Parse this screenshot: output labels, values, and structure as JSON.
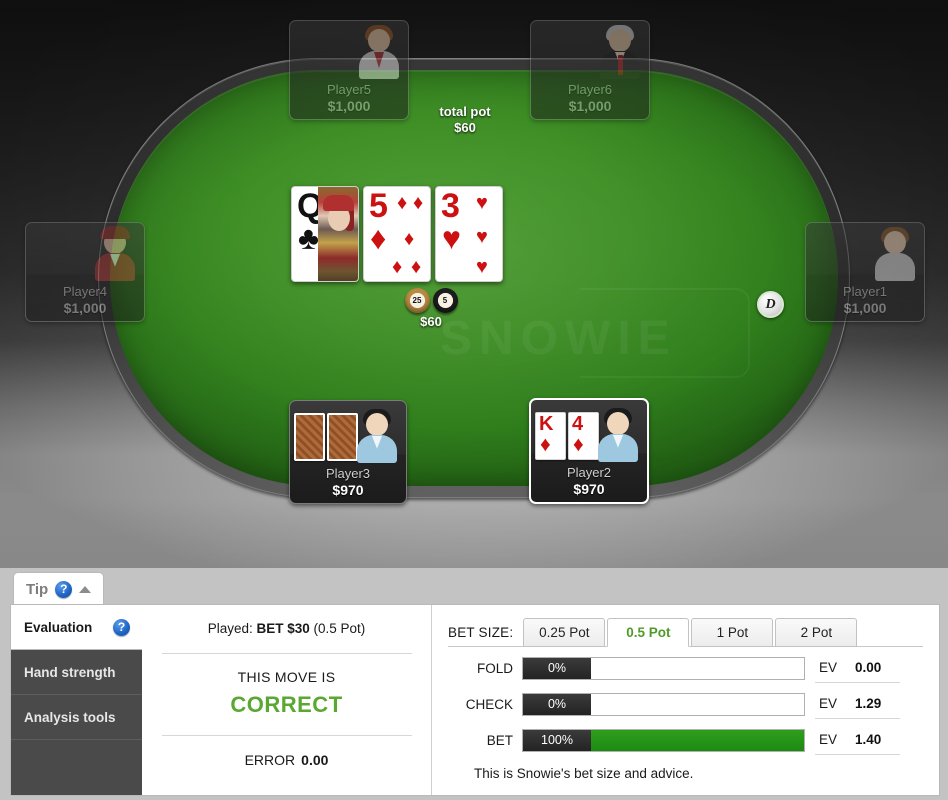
{
  "table": {
    "total_pot_label": "total pot",
    "total_pot_value": "$60",
    "pot_chips_amount": "$60",
    "chip_denominations": [
      "25",
      "5"
    ],
    "dealer_button_label": "D",
    "felt_watermark": "SNOWIE",
    "felt_color": "#3f8f26",
    "seats": [
      {
        "name": "Player5",
        "stack": "$1,000",
        "state": "folded",
        "avatar": "woman-red-hair"
      },
      {
        "name": "Player6",
        "stack": "$1,000",
        "state": "folded",
        "avatar": "man-suit-tie"
      },
      {
        "name": "Player4",
        "stack": "$1,000",
        "state": "folded",
        "avatar": "man-red-cap"
      },
      {
        "name": "Player1",
        "stack": "$1,000",
        "state": "folded",
        "avatar": "woman-brown-hair"
      },
      {
        "name": "Player3",
        "stack": "$970",
        "state": "active",
        "avatar": "man-blue-shirt"
      },
      {
        "name": "Player2",
        "stack": "$970",
        "state": "hero",
        "avatar": "man-blue-shirt"
      }
    ],
    "board_cards": [
      {
        "rank": "Q",
        "suit": "♣",
        "color": "black",
        "face": true
      },
      {
        "rank": "5",
        "suit": "♦",
        "color": "red",
        "face": false
      },
      {
        "rank": "3",
        "suit": "♥",
        "color": "red",
        "face": false
      }
    ],
    "hero_cards": [
      {
        "rank": "K",
        "suit": "♦",
        "color": "red"
      },
      {
        "rank": "4",
        "suit": "♦",
        "color": "red"
      }
    ]
  },
  "tip_tab": {
    "label": "Tip",
    "help_icon": "?",
    "collapse_icon": "chevron-up"
  },
  "side_tabs": [
    {
      "label": "Evaluation",
      "active": true,
      "help_icon": "?"
    },
    {
      "label": "Hand strength",
      "active": false
    },
    {
      "label": "Analysis tools",
      "active": false
    }
  ],
  "evaluation": {
    "played_prefix": "Played: ",
    "played_action": "BET $30",
    "played_suffix": " (0.5 Pot)",
    "move_label": "THIS MOVE IS",
    "verdict": "CORRECT",
    "verdict_color": "#5aa832",
    "error_label": "ERROR",
    "error_value": "0.00"
  },
  "advice": {
    "bet_size_label": "BET SIZE:",
    "bet_size_tabs": [
      {
        "label": "0.25 Pot",
        "active": false
      },
      {
        "label": "0.5 Pot",
        "active": true
      },
      {
        "label": "1 Pot",
        "active": false
      },
      {
        "label": "2 Pot",
        "active": false
      }
    ],
    "actions": [
      {
        "name": "FOLD",
        "percent": "0%",
        "fill": 0,
        "ev_label": "EV",
        "ev_value": "0.00"
      },
      {
        "name": "CHECK",
        "percent": "0%",
        "fill": 0,
        "ev_label": "EV",
        "ev_value": "1.29"
      },
      {
        "name": "BET",
        "percent": "100%",
        "fill": 100,
        "ev_label": "EV",
        "ev_value": "1.40"
      }
    ],
    "note": "This is Snowie's bet size and advice."
  }
}
